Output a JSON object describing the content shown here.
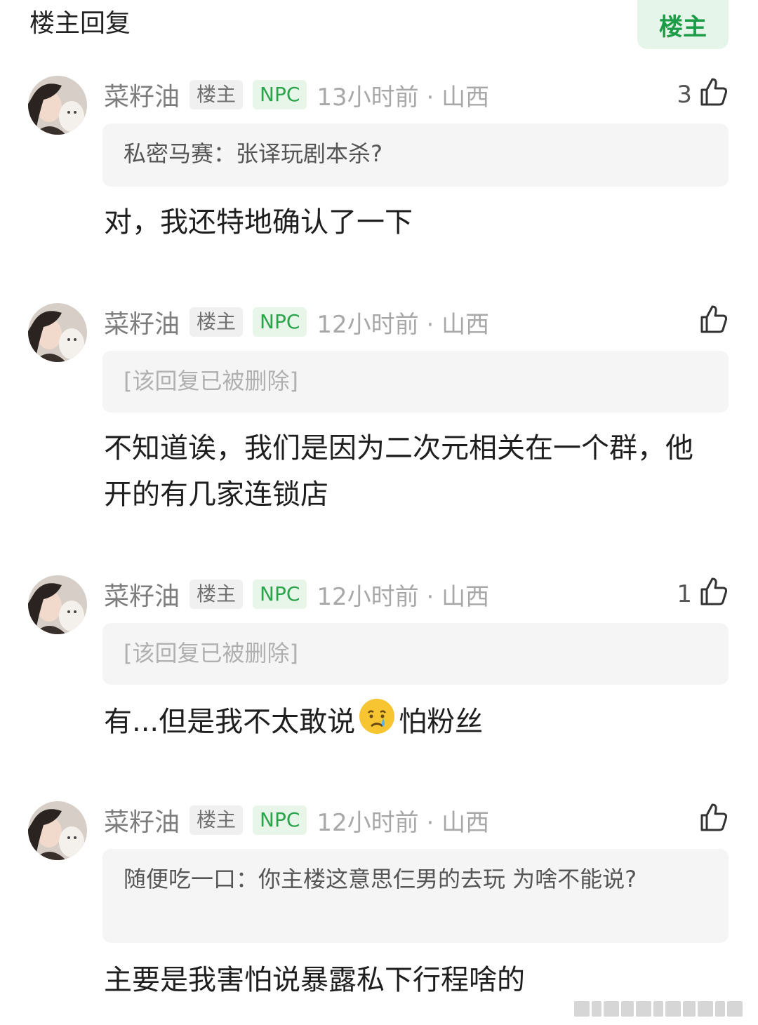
{
  "header": {
    "title": "楼主回复",
    "op_filter_label": "楼主"
  },
  "comments": [
    {
      "username": "菜籽油",
      "op_badge": "楼主",
      "npc_badge": "NPC",
      "time_location": "13小时前 · 山西",
      "like_count": "3",
      "quote": "私密马赛：张译玩剧本杀?",
      "quote_deleted": false,
      "text": "对，我还特地确认了一下"
    },
    {
      "username": "菜籽油",
      "op_badge": "楼主",
      "npc_badge": "NPC",
      "time_location": "12小时前 · 山西",
      "like_count": "",
      "quote": "[该回复已被删除]",
      "quote_deleted": true,
      "text": "不知道诶，我们是因为二次元相关在一个群，他开的有几家连锁店"
    },
    {
      "username": "菜籽油",
      "op_badge": "楼主",
      "npc_badge": "NPC",
      "time_location": "12小时前 · 山西",
      "like_count": "1",
      "quote": "[该回复已被删除]",
      "quote_deleted": true,
      "text_before_emoji": "有...但是我不太敢说",
      "emoji": "crying-face",
      "text_after_emoji": "怕粉丝"
    },
    {
      "username": "菜籽油",
      "op_badge": "楼主",
      "npc_badge": "NPC",
      "time_location": "12小时前 · 山西",
      "like_count": "",
      "quote": "随便吃一口：你主楼这意思仨男的去玩 为啥不能说?",
      "quote_deleted": false,
      "text": "主要是我害怕说暴露私下行程啥的"
    }
  ],
  "colors": {
    "accent_green": "#1c9c46",
    "npc_green": "#2aa34b",
    "muted_text": "#7d7d7d",
    "quote_bg": "#f5f5f5"
  },
  "icons": {
    "like": "thumbs-up-icon",
    "avatar": "user-avatar",
    "emoji": "crying-face-emoji"
  }
}
